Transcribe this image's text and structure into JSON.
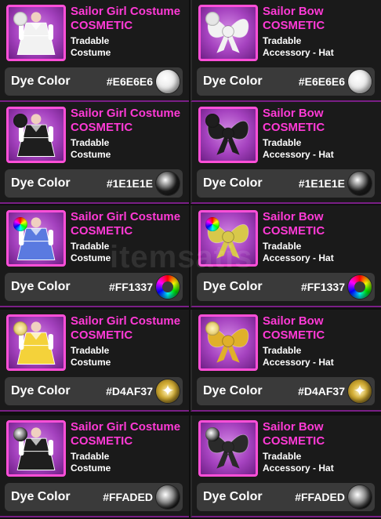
{
  "colors": {
    "accent": "#ff3ad6",
    "thumb_border": "#ff4fd8",
    "thumb_bg": "#a542bf",
    "dye_panel": "#3a3a3a",
    "card_bg": "#1a1a1a"
  },
  "watermark": "itemsatis",
  "items": [
    {
      "name": "Sailor Girl Costume",
      "kind": "COSMETIC",
      "tradable": "Tradable",
      "type": "Costume",
      "dye_label": "Dye Color",
      "dye_hex": "#E6E6E6",
      "swatch": "solid",
      "swatch_color": "#E6E6E6",
      "icon": "costume-white-icon",
      "art": "costume",
      "art_color": "#f2f2f2"
    },
    {
      "name": "Sailor Bow",
      "kind": "COSMETIC",
      "tradable": "Tradable",
      "type": "Accessory - Hat",
      "dye_label": "Dye Color",
      "dye_hex": "#E6E6E6",
      "swatch": "solid",
      "swatch_color": "#E6E6E6",
      "icon": "bow-white-icon",
      "art": "bow",
      "art_color": "#f2f2f2"
    },
    {
      "name": "Sailor Girl Costume",
      "kind": "COSMETIC",
      "tradable": "Tradable",
      "type": "Costume",
      "dye_label": "Dye Color",
      "dye_hex": "#1E1E1E",
      "swatch": "solid",
      "swatch_color": "#1E1E1E",
      "icon": "costume-black-icon",
      "art": "costume",
      "art_color": "#1e1e1e"
    },
    {
      "name": "Sailor Bow",
      "kind": "COSMETIC",
      "tradable": "Tradable",
      "type": "Accessory - Hat",
      "dye_label": "Dye Color",
      "dye_hex": "#1E1E1E",
      "swatch": "solid",
      "swatch_color": "#1E1E1E",
      "icon": "bow-black-icon",
      "art": "bow",
      "art_color": "#1e1e1e"
    },
    {
      "name": "Sailor Girl Costume",
      "kind": "COSMETIC",
      "tradable": "Tradable",
      "type": "Costume",
      "dye_label": "Dye Color",
      "dye_hex": "#FF1337",
      "swatch": "rainbow",
      "swatch_color": "#FF1337",
      "icon": "costume-rainbow-icon",
      "art": "costume",
      "art_color": "#5a7ae0"
    },
    {
      "name": "Sailor Bow",
      "kind": "COSMETIC",
      "tradable": "Tradable",
      "type": "Accessory - Hat",
      "dye_label": "Dye Color",
      "dye_hex": "#FF1337",
      "swatch": "rainbow",
      "swatch_color": "#FF1337",
      "icon": "bow-rainbow-icon",
      "art": "bow",
      "art_color": "#d8c84a"
    },
    {
      "name": "Sailor Girl Costume",
      "kind": "COSMETIC",
      "tradable": "Tradable",
      "type": "Costume",
      "dye_label": "Dye Color",
      "dye_hex": "#D4AF37",
      "swatch": "sparkle",
      "swatch_color": "#D4AF37",
      "icon": "costume-gold-icon",
      "art": "costume",
      "art_color": "#f4d23a"
    },
    {
      "name": "Sailor Bow",
      "kind": "COSMETIC",
      "tradable": "Tradable",
      "type": "Accessory - Hat",
      "dye_label": "Dye Color",
      "dye_hex": "#D4AF37",
      "swatch": "sparkle",
      "swatch_color": "#D4AF37",
      "icon": "bow-gold-icon",
      "art": "bow",
      "art_color": "#e0b02a"
    },
    {
      "name": "Sailor Girl Costume",
      "kind": "COSMETIC",
      "tradable": "Tradable",
      "type": "Costume",
      "dye_label": "Dye Color",
      "dye_hex": "#FFADED",
      "swatch": "faded",
      "swatch_color": "#FFADED",
      "icon": "costume-faded-icon",
      "art": "costume",
      "art_color": "#1e1e1e"
    },
    {
      "name": "Sailor Bow",
      "kind": "COSMETIC",
      "tradable": "Tradable",
      "type": "Accessory - Hat",
      "dye_label": "Dye Color",
      "dye_hex": "#FFADED",
      "swatch": "faded",
      "swatch_color": "#FFADED",
      "icon": "bow-faded-icon",
      "art": "bow",
      "art_color": "#2a2a2a"
    }
  ]
}
